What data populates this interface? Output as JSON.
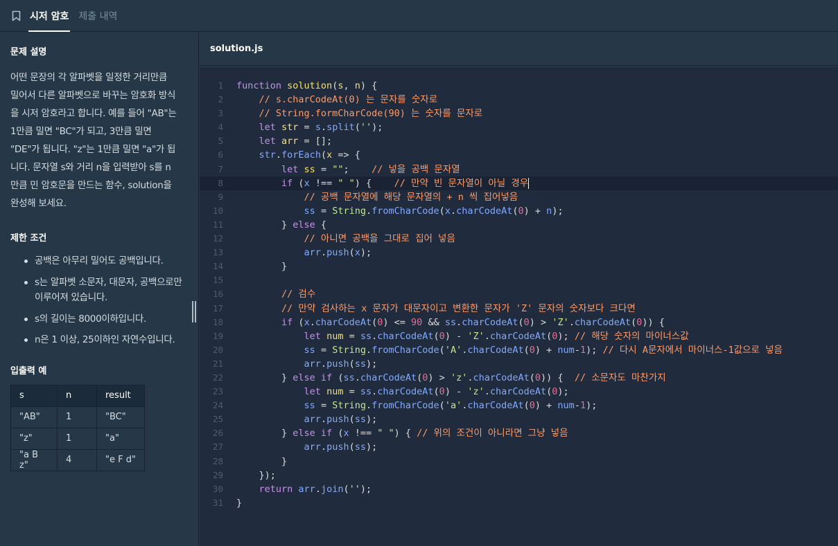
{
  "tabs": {
    "active_label": "시저 암호",
    "inactive_label": "제출 내역"
  },
  "problem": {
    "desc_title": "문제 설명",
    "description": "어떤 문장의 각 알파벳을 일정한 거리만큼 밀어서 다른 알파벳으로 바꾸는 암호화 방식을 시저 암호라고 합니다. 예를 들어 \"AB\"는 1만큼 밀면 \"BC\"가 되고, 3만큼 밀면 \"DE\"가 됩니다. \"z\"는 1만큼 밀면 \"a\"가 됩니다. 문자열 s와 거리 n을 입력받아 s를 n만큼 민 암호문을 만드는 함수, solution을 완성해 보세요.",
    "cond_title": "제한 조건",
    "conditions": [
      "공백은 아무리 밀어도 공백입니다.",
      "s는 알파벳 소문자, 대문자, 공백으로만 이루어져 있습니다.",
      "s의 길이는 8000이하입니다.",
      "n은 1 이상, 25이하인 자연수입니다."
    ],
    "io_title": "입출력 예",
    "io_headers": [
      "s",
      "n",
      "result"
    ],
    "io_rows": [
      [
        "\"AB\"",
        "1",
        "\"BC\""
      ],
      [
        "\"z\"",
        "1",
        "\"a\""
      ],
      [
        "\"a B z\"",
        "4",
        "\"e F d\""
      ]
    ]
  },
  "editor": {
    "file_name": "solution.js",
    "active_line": 8,
    "lines": [
      [
        [
          "k",
          "function "
        ],
        [
          "v",
          "solution"
        ],
        [
          "b",
          "("
        ],
        [
          "v",
          "s"
        ],
        [
          "b",
          ", "
        ],
        [
          "v",
          "n"
        ],
        [
          "b",
          ") {"
        ]
      ],
      [
        [
          "b",
          "    "
        ],
        [
          "c",
          "// s.charCodeAt(0) 는 문자를 숫자로"
        ]
      ],
      [
        [
          "b",
          "    "
        ],
        [
          "c",
          "// String.formCharCode(90) 는 숫자를 문자로"
        ]
      ],
      [
        [
          "b",
          "    "
        ],
        [
          "k",
          "let "
        ],
        [
          "v",
          "str"
        ],
        [
          "b",
          " = "
        ],
        [
          "f",
          "s"
        ],
        [
          "b",
          "."
        ],
        [
          "f",
          "split"
        ],
        [
          "b",
          "("
        ],
        [
          "s",
          "''"
        ],
        [
          "b",
          ");"
        ]
      ],
      [
        [
          "b",
          "    "
        ],
        [
          "k",
          "let "
        ],
        [
          "v",
          "arr"
        ],
        [
          "b",
          " = [];"
        ]
      ],
      [
        [
          "b",
          "    "
        ],
        [
          "f",
          "str"
        ],
        [
          "b",
          "."
        ],
        [
          "f",
          "forEach"
        ],
        [
          "b",
          "("
        ],
        [
          "v",
          "x"
        ],
        [
          "b",
          " => {"
        ]
      ],
      [
        [
          "b",
          "        "
        ],
        [
          "k",
          "let "
        ],
        [
          "v",
          "ss"
        ],
        [
          "b",
          " = "
        ],
        [
          "s",
          "\"\""
        ],
        [
          "b",
          ";    "
        ],
        [
          "c",
          "// 넣을 공백 문자열"
        ]
      ],
      [
        [
          "b",
          "        "
        ],
        [
          "k",
          "if"
        ],
        [
          "b",
          " ("
        ],
        [
          "f",
          "x"
        ],
        [
          "b",
          " !== "
        ],
        [
          "s",
          "\" \""
        ],
        [
          "b",
          ") {    "
        ],
        [
          "c",
          "// 만약 빈 문자열이 아닐 경우"
        ]
      ],
      [
        [
          "b",
          "            "
        ],
        [
          "c",
          "// 공백 문자열에 해당 문자열의 + n 씩 집어넣음"
        ]
      ],
      [
        [
          "b",
          "            "
        ],
        [
          "f",
          "ss"
        ],
        [
          "b",
          " = "
        ],
        [
          "s",
          "String"
        ],
        [
          "b",
          "."
        ],
        [
          "f",
          "fromCharCode"
        ],
        [
          "b",
          "("
        ],
        [
          "f",
          "x"
        ],
        [
          "b",
          "."
        ],
        [
          "f",
          "charCodeAt"
        ],
        [
          "b",
          "("
        ],
        [
          "p",
          "0"
        ],
        [
          "b",
          ") + "
        ],
        [
          "f",
          "n"
        ],
        [
          "b",
          ");"
        ]
      ],
      [
        [
          "b",
          "        } "
        ],
        [
          "k",
          "else"
        ],
        [
          "b",
          " {"
        ]
      ],
      [
        [
          "b",
          "            "
        ],
        [
          "c",
          "// 아니면 공백을 그대로 집어 넣음"
        ]
      ],
      [
        [
          "b",
          "            "
        ],
        [
          "f",
          "arr"
        ],
        [
          "b",
          "."
        ],
        [
          "f",
          "push"
        ],
        [
          "b",
          "("
        ],
        [
          "f",
          "x"
        ],
        [
          "b",
          ");"
        ]
      ],
      [
        [
          "b",
          "        }"
        ]
      ],
      [
        [
          "b",
          ""
        ]
      ],
      [
        [
          "b",
          "        "
        ],
        [
          "c",
          "// 검수"
        ]
      ],
      [
        [
          "b",
          "        "
        ],
        [
          "c",
          "// 만약 검사하는 x 문자가 대문자이고 변환한 문자가 'Z' 문자의 숫자보다 크다면"
        ]
      ],
      [
        [
          "b",
          "        "
        ],
        [
          "k",
          "if"
        ],
        [
          "b",
          " ("
        ],
        [
          "f",
          "x"
        ],
        [
          "b",
          "."
        ],
        [
          "f",
          "charCodeAt"
        ],
        [
          "b",
          "("
        ],
        [
          "p",
          "0"
        ],
        [
          "b",
          ") <= "
        ],
        [
          "p",
          "90"
        ],
        [
          "b",
          " && "
        ],
        [
          "f",
          "ss"
        ],
        [
          "b",
          "."
        ],
        [
          "f",
          "charCodeAt"
        ],
        [
          "b",
          "("
        ],
        [
          "p",
          "0"
        ],
        [
          "b",
          ") > "
        ],
        [
          "s",
          "'Z'"
        ],
        [
          "b",
          "."
        ],
        [
          "f",
          "charCodeAt"
        ],
        [
          "b",
          "("
        ],
        [
          "p",
          "0"
        ],
        [
          "b",
          ")) {"
        ]
      ],
      [
        [
          "b",
          "            "
        ],
        [
          "k",
          "let "
        ],
        [
          "v",
          "num"
        ],
        [
          "b",
          " = "
        ],
        [
          "f",
          "ss"
        ],
        [
          "b",
          "."
        ],
        [
          "f",
          "charCodeAt"
        ],
        [
          "b",
          "("
        ],
        [
          "p",
          "0"
        ],
        [
          "b",
          ") - "
        ],
        [
          "s",
          "'Z'"
        ],
        [
          "b",
          "."
        ],
        [
          "f",
          "charCodeAt"
        ],
        [
          "b",
          "("
        ],
        [
          "p",
          "0"
        ],
        [
          "b",
          "); "
        ],
        [
          "c",
          "// 해당 숫자의 마이너스값"
        ]
      ],
      [
        [
          "b",
          "            "
        ],
        [
          "f",
          "ss"
        ],
        [
          "b",
          " = "
        ],
        [
          "s",
          "String"
        ],
        [
          "b",
          "."
        ],
        [
          "f",
          "fromCharCode"
        ],
        [
          "b",
          "("
        ],
        [
          "s",
          "'A'"
        ],
        [
          "b",
          "."
        ],
        [
          "f",
          "charCodeAt"
        ],
        [
          "b",
          "("
        ],
        [
          "p",
          "0"
        ],
        [
          "b",
          ") + "
        ],
        [
          "f",
          "num"
        ],
        [
          "b",
          "-"
        ],
        [
          "p",
          "1"
        ],
        [
          "b",
          "); "
        ],
        [
          "c",
          "// 다시 A문자에서 마이너스-1값으로 넣음"
        ]
      ],
      [
        [
          "b",
          "            "
        ],
        [
          "f",
          "arr"
        ],
        [
          "b",
          "."
        ],
        [
          "f",
          "push"
        ],
        [
          "b",
          "("
        ],
        [
          "f",
          "ss"
        ],
        [
          "b",
          ");"
        ]
      ],
      [
        [
          "b",
          "        } "
        ],
        [
          "k",
          "else if"
        ],
        [
          "b",
          " ("
        ],
        [
          "f",
          "ss"
        ],
        [
          "b",
          "."
        ],
        [
          "f",
          "charCodeAt"
        ],
        [
          "b",
          "("
        ],
        [
          "p",
          "0"
        ],
        [
          "b",
          ") > "
        ],
        [
          "s",
          "'z'"
        ],
        [
          "b",
          "."
        ],
        [
          "f",
          "charCodeAt"
        ],
        [
          "b",
          "("
        ],
        [
          "p",
          "0"
        ],
        [
          "b",
          ")) {  "
        ],
        [
          "c",
          "// 소문자도 마찬가지"
        ]
      ],
      [
        [
          "b",
          "            "
        ],
        [
          "k",
          "let "
        ],
        [
          "v",
          "num"
        ],
        [
          "b",
          " = "
        ],
        [
          "f",
          "ss"
        ],
        [
          "b",
          "."
        ],
        [
          "f",
          "charCodeAt"
        ],
        [
          "b",
          "("
        ],
        [
          "p",
          "0"
        ],
        [
          "b",
          ") - "
        ],
        [
          "s",
          "'z'"
        ],
        [
          "b",
          "."
        ],
        [
          "f",
          "charCodeAt"
        ],
        [
          "b",
          "("
        ],
        [
          "p",
          "0"
        ],
        [
          "b",
          ");"
        ]
      ],
      [
        [
          "b",
          "            "
        ],
        [
          "f",
          "ss"
        ],
        [
          "b",
          " = "
        ],
        [
          "s",
          "String"
        ],
        [
          "b",
          "."
        ],
        [
          "f",
          "fromCharCode"
        ],
        [
          "b",
          "("
        ],
        [
          "s",
          "'a'"
        ],
        [
          "b",
          "."
        ],
        [
          "f",
          "charCodeAt"
        ],
        [
          "b",
          "("
        ],
        [
          "p",
          "0"
        ],
        [
          "b",
          ") + "
        ],
        [
          "f",
          "num"
        ],
        [
          "b",
          "-"
        ],
        [
          "p",
          "1"
        ],
        [
          "b",
          ");"
        ]
      ],
      [
        [
          "b",
          "            "
        ],
        [
          "f",
          "arr"
        ],
        [
          "b",
          "."
        ],
        [
          "f",
          "push"
        ],
        [
          "b",
          "("
        ],
        [
          "f",
          "ss"
        ],
        [
          "b",
          ");"
        ]
      ],
      [
        [
          "b",
          "        } "
        ],
        [
          "k",
          "else if"
        ],
        [
          "b",
          " ("
        ],
        [
          "f",
          "x"
        ],
        [
          "b",
          " !== "
        ],
        [
          "s",
          "\" \""
        ],
        [
          "b",
          ") { "
        ],
        [
          "c",
          "// 위의 조건이 아니라면 그냥 넣음"
        ]
      ],
      [
        [
          "b",
          "            "
        ],
        [
          "f",
          "arr"
        ],
        [
          "b",
          "."
        ],
        [
          "f",
          "push"
        ],
        [
          "b",
          "("
        ],
        [
          "f",
          "ss"
        ],
        [
          "b",
          ");"
        ]
      ],
      [
        [
          "b",
          "        }"
        ]
      ],
      [
        [
          "b",
          "    });"
        ]
      ],
      [
        [
          "b",
          "    "
        ],
        [
          "k",
          "return "
        ],
        [
          "f",
          "arr"
        ],
        [
          "b",
          "."
        ],
        [
          "f",
          "join"
        ],
        [
          "b",
          "("
        ],
        [
          "s",
          "''"
        ],
        [
          "b",
          ");"
        ]
      ],
      [
        [
          "b",
          "}"
        ]
      ]
    ]
  }
}
